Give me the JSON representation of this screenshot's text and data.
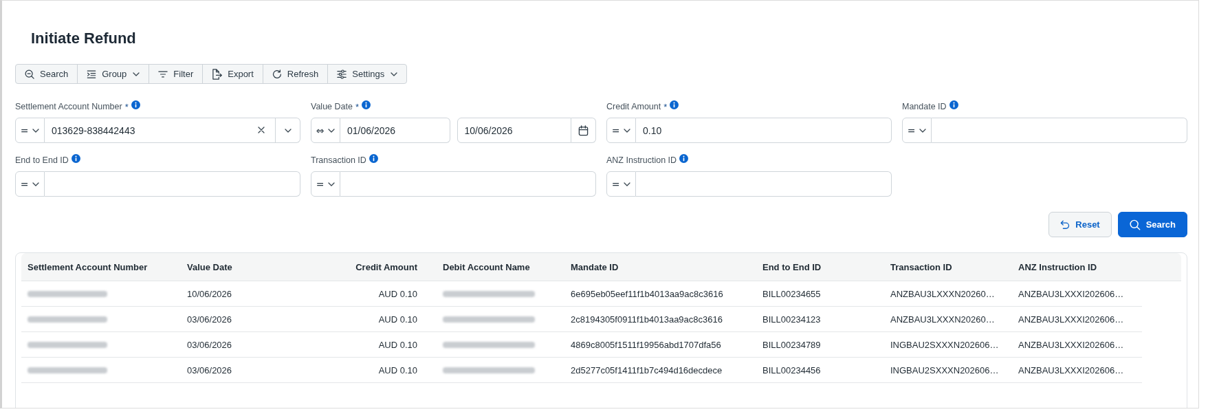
{
  "page": {
    "title": "Initiate Refund"
  },
  "toolbar": [
    {
      "kind": "search",
      "label": "Search",
      "dropdown": false
    },
    {
      "kind": "group",
      "label": "Group",
      "dropdown": true
    },
    {
      "kind": "filter",
      "label": "Filter",
      "dropdown": false
    },
    {
      "kind": "export",
      "label": "Export",
      "dropdown": false
    },
    {
      "kind": "refresh",
      "label": "Refresh",
      "dropdown": false
    },
    {
      "kind": "settings",
      "label": "Settings",
      "dropdown": true
    }
  ],
  "filters": [
    {
      "kind": "select",
      "label": "Settlement Account Number",
      "required_mark": "*",
      "operator": "=",
      "value": "013629-838442443"
    },
    {
      "kind": "date_range",
      "label": "Value Date",
      "required_mark": "*",
      "operator": "⇔",
      "from": "01/06/2026",
      "to": "10/06/2026"
    },
    {
      "kind": "text",
      "label": "Credit Amount",
      "required_mark": "*",
      "operator": "=",
      "value": "0.10"
    },
    {
      "kind": "text",
      "label": "Mandate ID",
      "operator": "="
    },
    {
      "kind": "text",
      "label": "End to End ID",
      "operator": "="
    },
    {
      "kind": "text",
      "label": "Transaction ID",
      "operator": "="
    },
    {
      "kind": "text",
      "label": "ANZ Instruction ID",
      "operator": "="
    }
  ],
  "actions": [
    {
      "kind": "reset",
      "label": "Reset"
    },
    {
      "kind": "search",
      "label": "Search"
    }
  ],
  "table": {
    "columns": [
      "Settlement Account Number",
      "Value Date",
      "Credit Amount",
      "Debit Account Name",
      "Mandate ID",
      "End to End ID",
      "Transaction ID",
      "ANZ Instruction ID"
    ],
    "rows": [
      {
        "cells": [
          {
            "kind": "redacted"
          },
          {
            "kind": "text",
            "text": "10/06/2026"
          },
          {
            "kind": "text",
            "text": "AUD 0.10"
          },
          {
            "kind": "redacted"
          },
          {
            "kind": "text",
            "text": "6e695eb05eef11f1b4013aa9ac8c3616"
          },
          {
            "kind": "text",
            "text": "BILL00234655"
          },
          {
            "kind": "text",
            "text": "ANZBAU3LXXXN20260…"
          },
          {
            "kind": "text",
            "text": "ANZBAU3LXXXI202606…"
          }
        ]
      },
      {
        "cells": [
          {
            "kind": "redacted"
          },
          {
            "kind": "text",
            "text": "03/06/2026"
          },
          {
            "kind": "text",
            "text": "AUD 0.10"
          },
          {
            "kind": "redacted"
          },
          {
            "kind": "text",
            "text": "2c8194305f0911f1b4013aa9ac8c3616"
          },
          {
            "kind": "text",
            "text": "BILL00234123"
          },
          {
            "kind": "text",
            "text": "ANZBAU3LXXXN20260…"
          },
          {
            "kind": "text",
            "text": "ANZBAU3LXXXI202606…"
          }
        ]
      },
      {
        "cells": [
          {
            "kind": "redacted"
          },
          {
            "kind": "text",
            "text": "03/06/2026"
          },
          {
            "kind": "text",
            "text": "AUD 0.10"
          },
          {
            "kind": "redacted"
          },
          {
            "kind": "text",
            "text": "4869c8005f1511f19956abd1707dfa56"
          },
          {
            "kind": "text",
            "text": "BILL00234789"
          },
          {
            "kind": "text",
            "text": "INGBAU2SXXXN202606…"
          },
          {
            "kind": "text",
            "text": "ANZBAU3LXXXI202606…"
          }
        ]
      },
      {
        "cells": [
          {
            "kind": "redacted"
          },
          {
            "kind": "text",
            "text": "03/06/2026"
          },
          {
            "kind": "text",
            "text": "AUD 0.10"
          },
          {
            "kind": "redacted"
          },
          {
            "kind": "text",
            "text": "2d5277c05f1411f1b7c494d16decdece"
          },
          {
            "kind": "text",
            "text": "BILL00234456"
          },
          {
            "kind": "text",
            "text": "INGBAU2SXXXN202606…"
          },
          {
            "kind": "text",
            "text": "ANZBAU3LXXXI202606…"
          }
        ]
      }
    ]
  }
}
